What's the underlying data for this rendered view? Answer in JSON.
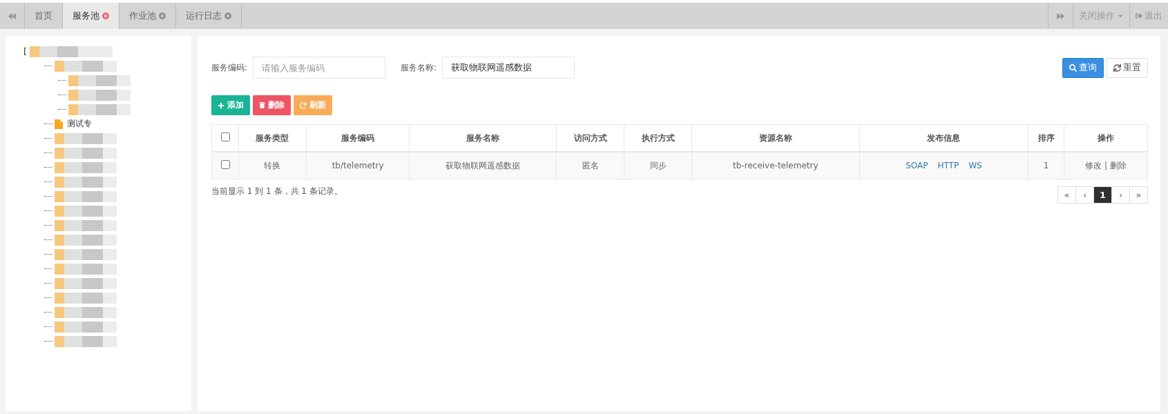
{
  "tabs": [
    {
      "label": "首页",
      "selected": false,
      "closable": false
    },
    {
      "label": "服务池",
      "selected": true,
      "closable": true
    },
    {
      "label": "作业池",
      "selected": false,
      "closable": true
    },
    {
      "label": "运行日志",
      "selected": false,
      "closable": true
    }
  ],
  "top_actions": {
    "close_menu": "关闭操作",
    "logout": "退出"
  },
  "tree": {
    "root_bracket": "[",
    "items": [
      {
        "kind": "redacted",
        "children": [
          {
            "kind": "redacted"
          },
          {
            "kind": "redacted"
          },
          {
            "kind": "redacted"
          }
        ]
      },
      {
        "kind": "file",
        "label": "测试专"
      },
      {
        "kind": "redacted"
      },
      {
        "kind": "redacted"
      },
      {
        "kind": "redacted"
      },
      {
        "kind": "redacted"
      },
      {
        "kind": "redacted"
      },
      {
        "kind": "redacted"
      },
      {
        "kind": "redacted"
      },
      {
        "kind": "redacted"
      },
      {
        "kind": "redacted"
      },
      {
        "kind": "redacted"
      },
      {
        "kind": "redacted"
      },
      {
        "kind": "redacted"
      },
      {
        "kind": "redacted"
      },
      {
        "kind": "redacted"
      },
      {
        "kind": "redacted"
      }
    ]
  },
  "search": {
    "fields": [
      {
        "label": "服务编码:",
        "placeholder": "请输入服务编码"
      },
      {
        "label": "服务名称:",
        "value": "获取物联网遥感数据"
      }
    ],
    "buttons": [
      {
        "kind": "primary",
        "label": "查询"
      },
      {
        "kind": "default",
        "label": "重置"
      }
    ]
  },
  "toolbar": [
    {
      "kind": "add",
      "label": "添加"
    },
    {
      "kind": "delete",
      "label": "删除"
    },
    {
      "kind": "refresh",
      "label": "刷新"
    }
  ],
  "table": {
    "select_all_checked": false,
    "columns": [
      "服务类型",
      "服务编码",
      "服务名称",
      "访问方式",
      "执行方式",
      "资源名称",
      "发布信息",
      "排序",
      "操作"
    ],
    "rows": [
      {
        "checked": false,
        "type": "转换",
        "code": "tb/telemetry",
        "name": "获取物联网遥感数据",
        "access": "匿名",
        "exec": "同步",
        "resource": "tb-receive-telemetry",
        "publish": [
          "SOAP",
          "HTTP",
          "WS"
        ],
        "order": "1",
        "actions": [
          "修改",
          "删除"
        ],
        "separator": "|"
      }
    ]
  },
  "summary": "当前显示 1 到 1 条，共 1 条记录。",
  "pagination": [
    {
      "label": "«",
      "selected": false
    },
    {
      "label": "‹",
      "selected": false
    },
    {
      "label": "1",
      "selected": true
    },
    {
      "label": "›",
      "selected": false
    },
    {
      "label": "»",
      "selected": false
    }
  ]
}
